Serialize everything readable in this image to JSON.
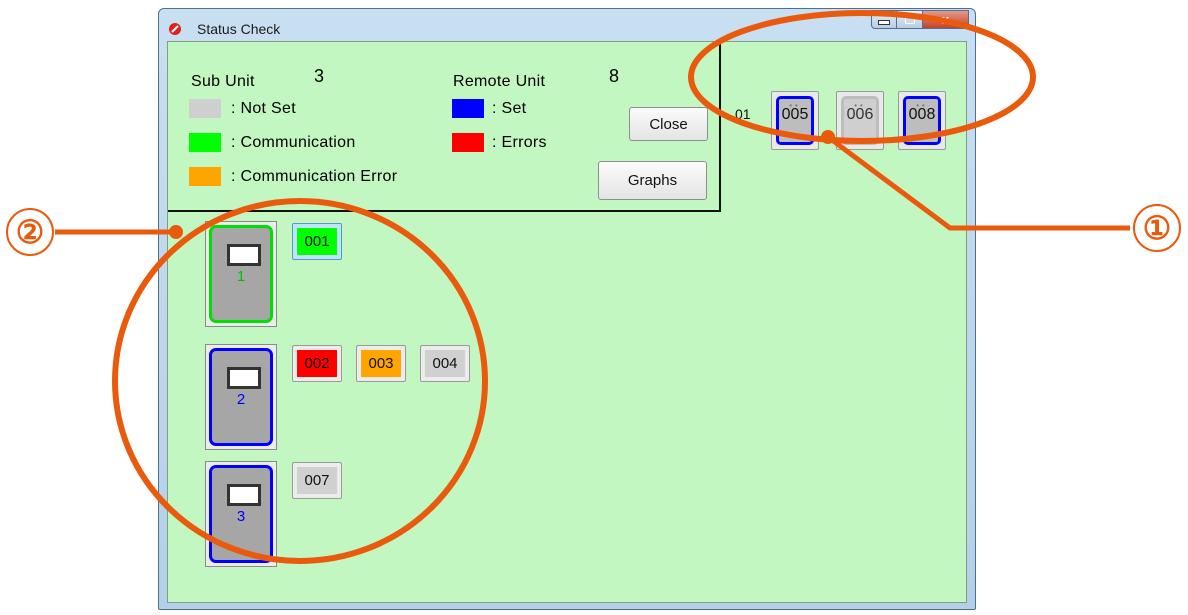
{
  "window": {
    "title": "Status Check",
    "close_glyph": "x"
  },
  "legend": {
    "sub_unit_label": "Sub Unit",
    "sub_unit_count": "3",
    "remote_unit_label": "Remote Unit",
    "remote_unit_count": "8",
    "not_set": ":  Not Set",
    "communication": ":  Communication",
    "communication_error": ":  Communication Error",
    "set": ":  Set",
    "errors": ":  Errors"
  },
  "buttons": {
    "close": "Close",
    "graphs": "Graphs"
  },
  "header_row": {
    "label": "01",
    "chips": [
      "005",
      "006",
      "008"
    ]
  },
  "sub_units": [
    {
      "number": "1",
      "remotes": [
        "001"
      ]
    },
    {
      "number": "2",
      "remotes": [
        "002",
        "003",
        "004"
      ]
    },
    {
      "number": "3",
      "remotes": [
        "007"
      ]
    }
  ],
  "annotations": {
    "marker_1": "①",
    "marker_2": "②"
  },
  "colors": {
    "background": "#c2f7c2",
    "not_set": "#cfcfcf",
    "communication": "#00ff00",
    "communication_error": "#ffa500",
    "set": "#0000ff",
    "errors": "#ff0000",
    "annotation": "#ea5a0c"
  }
}
